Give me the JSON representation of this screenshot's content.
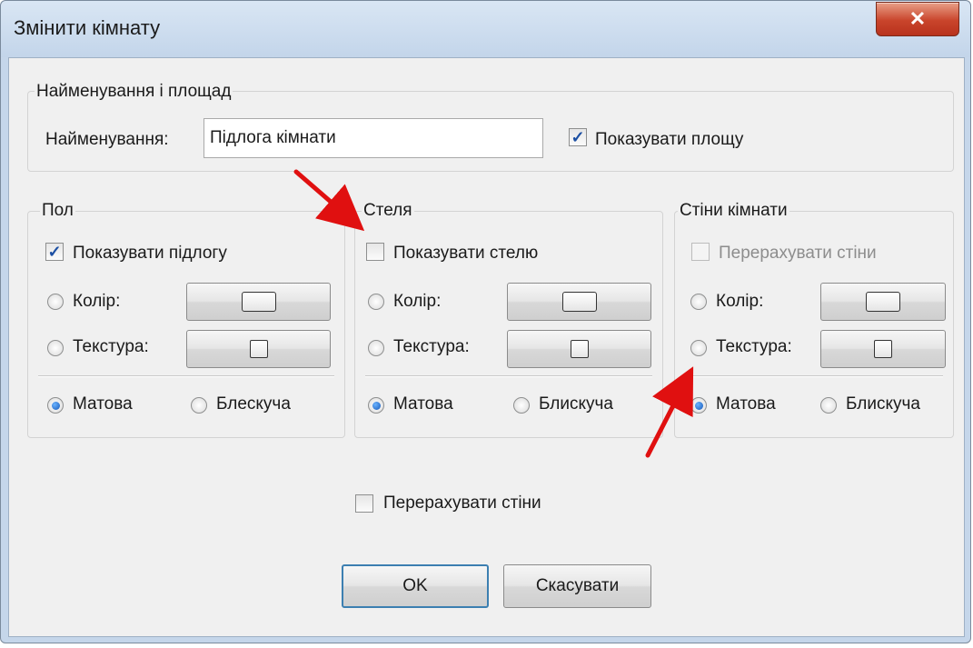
{
  "window": {
    "title": "Змінити кімнату",
    "close_glyph": "✕"
  },
  "name_area": {
    "group_title": "Найменування і площад",
    "name_label": "Найменування:",
    "name_value": "Підлога кімнати",
    "show_area_label": "Показувати площу",
    "show_area_checked": true
  },
  "floor": {
    "group_title": "Пол",
    "show_label": "Показувати підлогу",
    "show_checked": true,
    "color_label": "Колір:",
    "texture_label": "Текстура:",
    "matte_label": "Матова",
    "glossy_label": "Блескуча",
    "finish_selected": "Матова"
  },
  "ceiling": {
    "group_title": "Стеля",
    "show_label": "Показувати стелю",
    "show_checked": false,
    "color_label": "Колір:",
    "texture_label": "Текстура:",
    "matte_label": "Матова",
    "glossy_label": "Блискуча",
    "finish_selected": "Матова"
  },
  "walls": {
    "group_title": "Стіни кімнати",
    "recalc_label": "Перерахувати стіни",
    "recalc_checked": false,
    "recalc_disabled": true,
    "color_label": "Колір:",
    "texture_label": "Текстура:",
    "matte_label": "Матова",
    "glossy_label": "Блискуча",
    "finish_selected": "Матова"
  },
  "bottom": {
    "recalc_walls_label": "Перерахувати стіни",
    "recalc_walls_checked": false,
    "ok_label": "OK",
    "cancel_label": "Скасувати"
  },
  "icons": {
    "check": "✓",
    "close": "close-icon",
    "color_swatch": "color-swatch-icon",
    "texture_swatch": "texture-swatch-icon",
    "annotation": "red-arrow-icon"
  },
  "colors": {
    "titlebar": "#c5d6ea",
    "close_button": "#c9442b",
    "dialog_bg": "#f0f0f0",
    "checkmark": "#1c4fa3",
    "radio_dot": "#1558b8",
    "annotation_arrow": "#e01010",
    "default_button_border": "#3c7fb1"
  }
}
